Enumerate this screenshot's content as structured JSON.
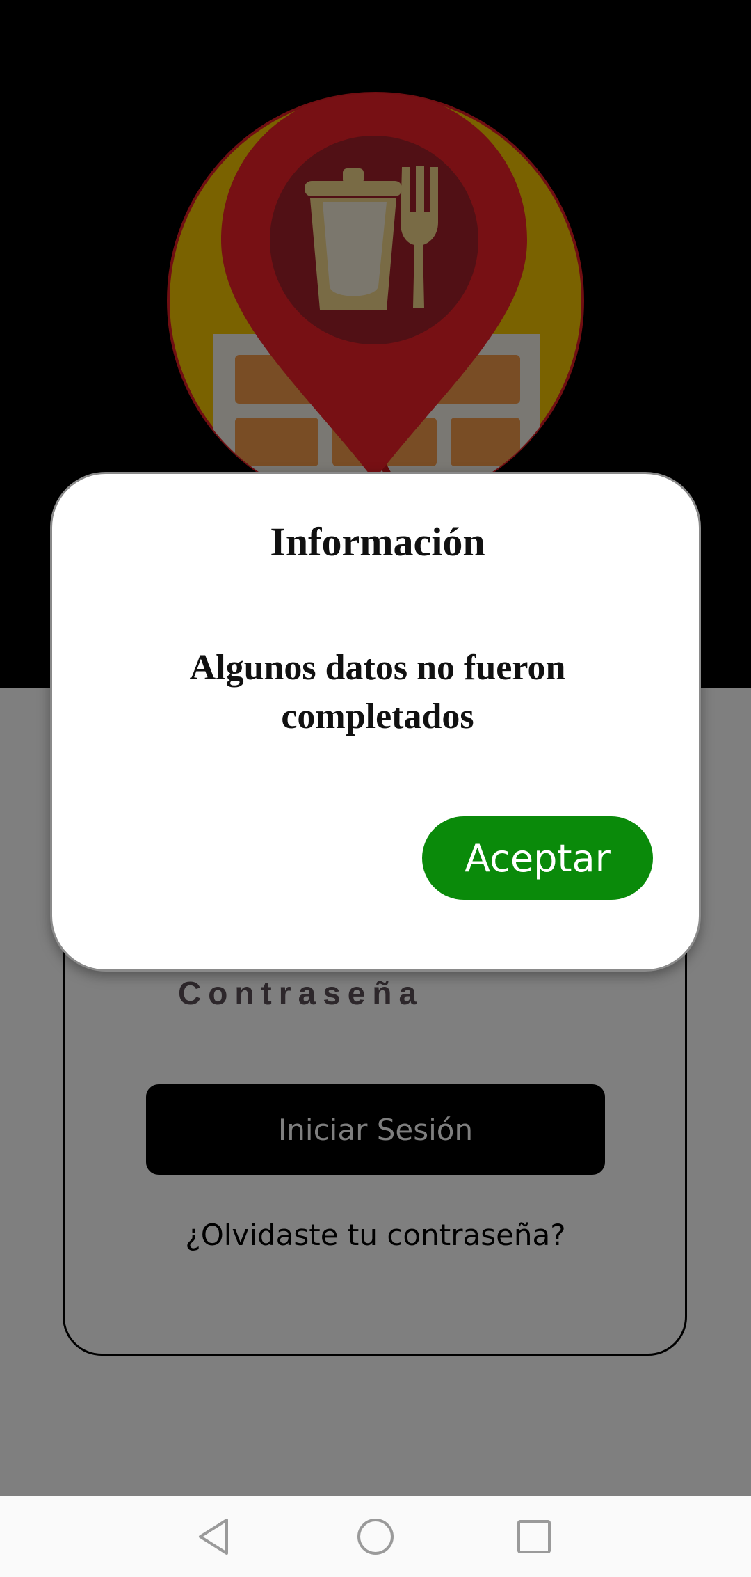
{
  "dialog": {
    "title": "Información",
    "message": "Algunos datos no fueron completados",
    "accept_label": "Aceptar"
  },
  "login": {
    "password_label": "Contraseña",
    "login_button_label": "Iniciar Sesión",
    "forgot_password_link": "¿Olvidaste tu contraseña?"
  },
  "navbar": {
    "back_icon": "back-triangle-icon",
    "home_icon": "home-circle-icon",
    "recents_icon": "recents-square-icon"
  },
  "colors": {
    "accept_button": "#0a8a0a",
    "top_background": "#000000",
    "pin_red": "#e11d24",
    "logo_yellow": "#f5c400"
  }
}
